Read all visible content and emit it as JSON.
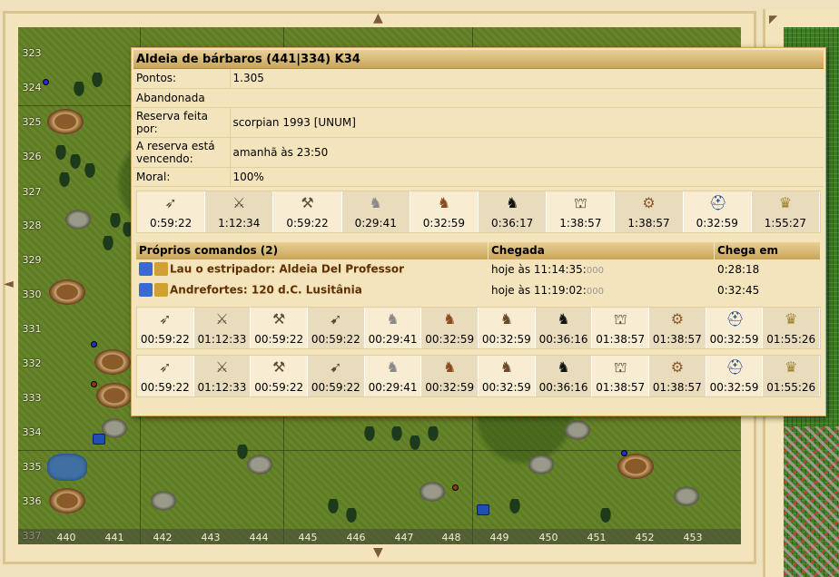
{
  "map": {
    "y_labels": [
      "323",
      "324",
      "325",
      "326",
      "327",
      "328",
      "329",
      "330",
      "331",
      "332",
      "333",
      "334",
      "335",
      "336",
      "337"
    ],
    "x_labels": [
      "440",
      "441",
      "442",
      "443",
      "444",
      "445",
      "446",
      "447",
      "448",
      "449",
      "450",
      "451",
      "452",
      "453"
    ],
    "nav_arrows": {
      "up": "▲",
      "down": "▼",
      "left": "◄",
      "corner": "◤"
    }
  },
  "popup": {
    "title": "Aldeia de bárbaros (441|334) K34",
    "rows": [
      {
        "key": "Pontos:",
        "value": "1.305"
      },
      {
        "key": "Abandonada",
        "value": ""
      },
      {
        "key": "Reserva feita por:",
        "value": "scorpian 1993 [UNUM]"
      },
      {
        "key": "A reserva está vencendo:",
        "value": "amanhã às 23:50"
      },
      {
        "key": "Moral:",
        "value": "100%"
      }
    ],
    "units_top": [
      {
        "icon": "spear-icon",
        "glyph": "➶",
        "time": "0:59:22"
      },
      {
        "icon": "sword-icon",
        "glyph": "⚔",
        "time": "1:12:34"
      },
      {
        "icon": "axe-icon",
        "glyph": "⚒",
        "time": "0:59:22"
      },
      {
        "icon": "scout-icon",
        "glyph": "♞",
        "time": "0:29:41"
      },
      {
        "icon": "light-cavalry-icon",
        "glyph": "♞",
        "time": "0:32:59"
      },
      {
        "icon": "heavy-cavalry-icon",
        "glyph": "♞",
        "time": "0:36:17"
      },
      {
        "icon": "ram-icon",
        "glyph": "⛫",
        "time": "1:38:57"
      },
      {
        "icon": "catapult-icon",
        "glyph": "⚙",
        "time": "1:38:57"
      },
      {
        "icon": "paladin-icon",
        "glyph": "⛑",
        "time": "0:32:59"
      },
      {
        "icon": "noble-icon",
        "glyph": "♛",
        "time": "1:55:27"
      }
    ],
    "commands_header": {
      "title": "Próprios comandos (2)",
      "arrival": "Chegada",
      "arrives_in": "Chega em"
    },
    "commands": [
      {
        "name": "Lau o estripador: Aldeia Del Professor",
        "arrival": "hoje às 11:14:35:",
        "ms": "000",
        "arrives_in": "0:28:18"
      },
      {
        "name": "Andrefortes: 120 d.C. Lusitânia",
        "arrival": "hoje às 11:19:02:",
        "ms": "000",
        "arrives_in": "0:32:45"
      }
    ],
    "units_row2": [
      {
        "icon": "spear-icon",
        "glyph": "➶",
        "time": "00:59:22"
      },
      {
        "icon": "sword-icon",
        "glyph": "⚔",
        "time": "01:12:33"
      },
      {
        "icon": "axe-icon",
        "glyph": "⚒",
        "time": "00:59:22"
      },
      {
        "icon": "archer-icon",
        "glyph": "➹",
        "time": "00:59:22"
      },
      {
        "icon": "scout-icon",
        "glyph": "♞",
        "time": "00:29:41"
      },
      {
        "icon": "light-cavalry-icon",
        "glyph": "♞",
        "time": "00:32:59"
      },
      {
        "icon": "mounted-archer-icon",
        "glyph": "♞",
        "time": "00:32:59"
      },
      {
        "icon": "heavy-cavalry-icon",
        "glyph": "♞",
        "time": "00:36:16"
      },
      {
        "icon": "ram-icon",
        "glyph": "⛫",
        "time": "01:38:57"
      },
      {
        "icon": "catapult-icon",
        "glyph": "⚙",
        "time": "01:38:57"
      },
      {
        "icon": "paladin-icon",
        "glyph": "⛑",
        "time": "00:32:59"
      },
      {
        "icon": "noble-icon",
        "glyph": "♛",
        "time": "01:55:26"
      }
    ],
    "units_row3": [
      {
        "icon": "spear-icon",
        "glyph": "➶",
        "time": "00:59:22"
      },
      {
        "icon": "sword-icon",
        "glyph": "⚔",
        "time": "01:12:33"
      },
      {
        "icon": "axe-icon",
        "glyph": "⚒",
        "time": "00:59:22"
      },
      {
        "icon": "archer-icon",
        "glyph": "➹",
        "time": "00:59:22"
      },
      {
        "icon": "scout-icon",
        "glyph": "♞",
        "time": "00:29:41"
      },
      {
        "icon": "light-cavalry-icon",
        "glyph": "♞",
        "time": "00:32:59"
      },
      {
        "icon": "mounted-archer-icon",
        "glyph": "♞",
        "time": "00:32:59"
      },
      {
        "icon": "heavy-cavalry-icon",
        "glyph": "♞",
        "time": "00:36:16"
      },
      {
        "icon": "ram-icon",
        "glyph": "⛫",
        "time": "01:38:57"
      },
      {
        "icon": "catapult-icon",
        "glyph": "⚙",
        "time": "01:38:57"
      },
      {
        "icon": "paladin-icon",
        "glyph": "⛑",
        "time": "00:32:59"
      },
      {
        "icon": "noble-icon",
        "glyph": "♛",
        "time": "01:55:26"
      }
    ]
  }
}
